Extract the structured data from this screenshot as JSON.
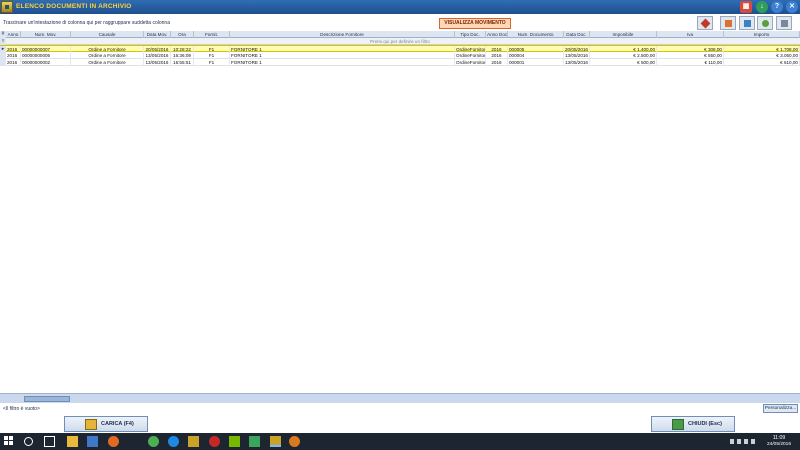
{
  "window": {
    "title": "ELENCO DOCUMENTI IN ARCHIVIO"
  },
  "toolbar": {
    "group_text": "Trascinare un'intestazione di colonna qui per raggruppare suddetta colonna",
    "visualizza_label": "VISUALIZZA MOVIMENTO"
  },
  "grid": {
    "headers": [
      "Anno",
      "Num. Mov.",
      "Causale",
      "Data Mov.",
      "Ora",
      "Fornit.",
      "Descrizione Fornitore",
      "Tipo Doc.",
      "Anno Doc.",
      "Num. Documento",
      "Data Doc.",
      "Imponibile",
      "Iva",
      "Importo"
    ],
    "filter_placeholder": "Premi qui per definire un filtro",
    "rows": [
      [
        "2016",
        "00000000007",
        "Ordine a Fornitore",
        "20/05/2016",
        "10:28:22",
        "F1",
        "FORNITORE 1",
        "OrdineFornitor",
        "2016",
        "000005",
        "20/05/2016",
        "€ 1.400,00",
        "€ 308,00",
        "€ 1.708,00"
      ],
      [
        "2016",
        "00000000005",
        "Ordine a Fornitore",
        "13/05/2016",
        "16:36:09",
        "F1",
        "FORNITORE 1",
        "OrdineFornitor",
        "2016",
        "000004",
        "13/05/2016",
        "€ 2.500,00",
        "€ 550,00",
        "€ 3.050,00"
      ],
      [
        "2016",
        "00000000002",
        "Ordine a Fornitore",
        "13/05/2016",
        "15:55:51",
        "F1",
        "FORNITORE 1",
        "OrdineFornitor",
        "2016",
        "000001",
        "13/05/2016",
        "€ 500,00",
        "€ 110,00",
        "€ 610,00"
      ]
    ]
  },
  "status": {
    "filter_text": "<Il filtro è vuoto>",
    "personalizza_label": "Personalizza..."
  },
  "buttons": {
    "carica_label": "CARICA (F4)",
    "chiudi_label": "CHIUDI (Esc)"
  },
  "taskbar": {
    "time": "11:09",
    "date": "24/05/2016"
  },
  "colors": {
    "title_bar": "#1d4f8e",
    "title_text": "#ffd23c",
    "selected_row": "#fffdb0",
    "visualizza_bg": "#ffd7b5"
  }
}
